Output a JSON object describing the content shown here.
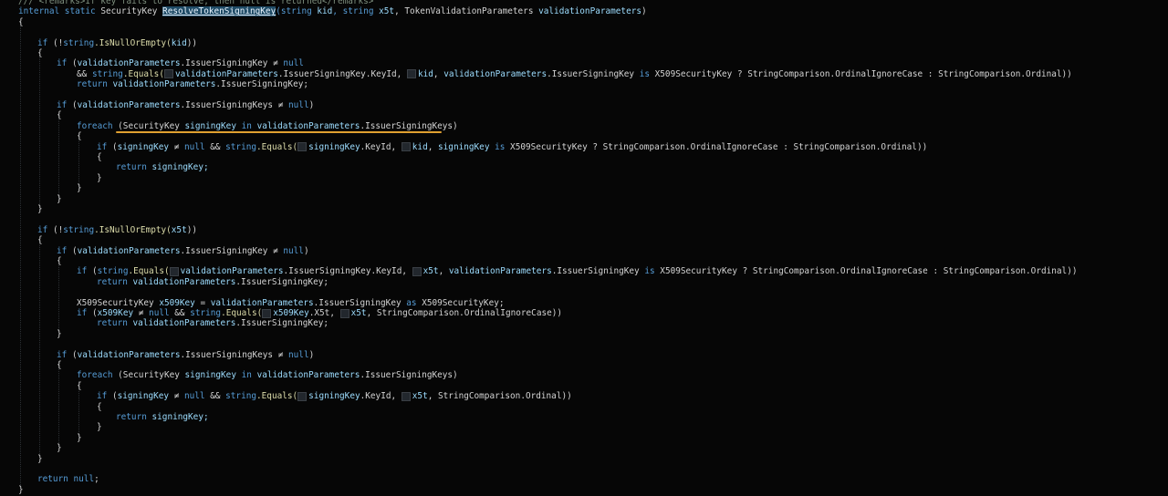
{
  "colors": {
    "background": "#060606",
    "keyword": "#569cd6",
    "identifier": "#9cdcfe",
    "text": "#d4d4d4",
    "comment": "#7e8f7e",
    "annotation": "#e0a030"
  },
  "code_lines": [
    {
      "indent": 1,
      "tokens": [
        {
          "t": "/// <remarks>If key fails to resolve, then null is returned</remarks>",
          "c": "cm"
        }
      ]
    },
    {
      "indent": 1,
      "tokens": [
        {
          "t": "internal static ",
          "c": "kw"
        },
        {
          "t": "SecurityKey ",
          "c": "ty"
        },
        {
          "t": "ResolveTokenSigningKey",
          "c": "hl"
        },
        {
          "t": "(string ",
          "c": "kw"
        },
        {
          "t": "kid",
          "c": "vr"
        },
        {
          "t": ", string ",
          "c": "kw"
        },
        {
          "t": "x5t",
          "c": "vr"
        },
        {
          "t": ", TokenValidationParameters ",
          "c": "ty"
        },
        {
          "t": "validationParameters",
          "c": "vr"
        },
        {
          "t": ")",
          "c": "pl"
        }
      ]
    },
    {
      "indent": 1,
      "tokens": [
        {
          "t": "{",
          "c": "pl"
        }
      ]
    },
    {
      "indent": 0,
      "tokens": []
    },
    {
      "indent": 2,
      "tokens": [
        {
          "t": "if ",
          "c": "kw"
        },
        {
          "t": "(!",
          "c": "pl"
        },
        {
          "t": "string",
          "c": "kw"
        },
        {
          "t": ".IsNullOrEmpty(",
          "c": "mt"
        },
        {
          "t": "kid",
          "c": "vr"
        },
        {
          "t": "))",
          "c": "pl"
        }
      ]
    },
    {
      "indent": 2,
      "tokens": [
        {
          "t": "{",
          "c": "pl"
        }
      ]
    },
    {
      "indent": 3,
      "tokens": [
        {
          "t": "if ",
          "c": "kw"
        },
        {
          "t": "(",
          "c": "pl"
        },
        {
          "t": "validationParameters",
          "c": "vr"
        },
        {
          "t": ".IssuerSigningKey ≠ ",
          "c": "pl"
        },
        {
          "t": "null",
          "c": "nu"
        }
      ]
    },
    {
      "indent": 4,
      "tokens": [
        {
          "t": "&& ",
          "c": "pl"
        },
        {
          "t": "string",
          "c": "kw"
        },
        {
          "t": ".Equals(",
          "c": "mt"
        },
        {
          "t": "",
          "c": "hint"
        },
        {
          "t": "validationParameters",
          "c": "vr"
        },
        {
          "t": ".IssuerSigningKey.KeyId, ",
          "c": "pl"
        },
        {
          "t": "",
          "c": "hint"
        },
        {
          "t": "kid",
          "c": "vr"
        },
        {
          "t": ", ",
          "c": "pl"
        },
        {
          "t": "validationParameters",
          "c": "vr"
        },
        {
          "t": ".IssuerSigningKey ",
          "c": "pl"
        },
        {
          "t": "is ",
          "c": "kw"
        },
        {
          "t": "X509SecurityKey ? StringComparison.OrdinalIgnoreCase : StringComparison.Ordinal))",
          "c": "pl"
        }
      ]
    },
    {
      "indent": 4,
      "tokens": [
        {
          "t": "return ",
          "c": "kw"
        },
        {
          "t": "validationParameters",
          "c": "vr"
        },
        {
          "t": ".IssuerSigningKey;",
          "c": "pl"
        }
      ]
    },
    {
      "indent": 0,
      "tokens": []
    },
    {
      "indent": 3,
      "tokens": [
        {
          "t": "if ",
          "c": "kw"
        },
        {
          "t": "(",
          "c": "pl"
        },
        {
          "t": "validationParameters",
          "c": "vr"
        },
        {
          "t": ".IssuerSigningKeys ≠ ",
          "c": "pl"
        },
        {
          "t": "null",
          "c": "nu"
        },
        {
          "t": ")",
          "c": "pl"
        }
      ]
    },
    {
      "indent": 3,
      "tokens": [
        {
          "t": "{",
          "c": "pl"
        }
      ]
    },
    {
      "indent": 4,
      "tokens": [
        {
          "t": "foreach ",
          "c": "kw"
        },
        {
          "t": "(SecurityKey ",
          "c": "pl"
        },
        {
          "t": "signingKey",
          "c": "vr"
        },
        {
          "t": " in ",
          "c": "kw"
        },
        {
          "t": "validationParameters",
          "c": "vr"
        },
        {
          "t": ".IssuerSigningKeys)",
          "c": "pl"
        }
      ]
    },
    {
      "indent": 4,
      "tokens": [
        {
          "t": "{",
          "c": "pl"
        }
      ]
    },
    {
      "indent": 5,
      "tokens": [
        {
          "t": "if ",
          "c": "kw"
        },
        {
          "t": "(",
          "c": "pl"
        },
        {
          "t": "signingKey",
          "c": "vr"
        },
        {
          "t": " ≠ ",
          "c": "pl"
        },
        {
          "t": "null",
          "c": "nu"
        },
        {
          "t": " && ",
          "c": "pl"
        },
        {
          "t": "string",
          "c": "kw"
        },
        {
          "t": ".Equals(",
          "c": "mt"
        },
        {
          "t": "",
          "c": "hint"
        },
        {
          "t": "signingKey",
          "c": "vr"
        },
        {
          "t": ".KeyId, ",
          "c": "pl"
        },
        {
          "t": "",
          "c": "hint"
        },
        {
          "t": "kid",
          "c": "vr"
        },
        {
          "t": ", ",
          "c": "pl"
        },
        {
          "t": "signingKey",
          "c": "vr"
        },
        {
          "t": " is ",
          "c": "kw"
        },
        {
          "t": "X509SecurityKey ? StringComparison.OrdinalIgnoreCase : StringComparison.Ordinal))",
          "c": "pl"
        }
      ]
    },
    {
      "indent": 5,
      "tokens": [
        {
          "t": "{",
          "c": "pl"
        }
      ]
    },
    {
      "indent": 6,
      "tokens": [
        {
          "t": "return ",
          "c": "kw"
        },
        {
          "t": "signingKey;",
          "c": "vr"
        }
      ]
    },
    {
      "indent": 5,
      "tokens": [
        {
          "t": "}",
          "c": "pl"
        }
      ]
    },
    {
      "indent": 4,
      "tokens": [
        {
          "t": "}",
          "c": "pl"
        }
      ]
    },
    {
      "indent": 3,
      "tokens": [
        {
          "t": "}",
          "c": "pl"
        }
      ]
    },
    {
      "indent": 2,
      "tokens": [
        {
          "t": "}",
          "c": "pl"
        }
      ]
    },
    {
      "indent": 0,
      "tokens": []
    },
    {
      "indent": 2,
      "tokens": [
        {
          "t": "if ",
          "c": "kw"
        },
        {
          "t": "(!",
          "c": "pl"
        },
        {
          "t": "string",
          "c": "kw"
        },
        {
          "t": ".IsNullOrEmpty(",
          "c": "mt"
        },
        {
          "t": "x5t",
          "c": "vr"
        },
        {
          "t": "))",
          "c": "pl"
        }
      ]
    },
    {
      "indent": 2,
      "tokens": [
        {
          "t": "{",
          "c": "pl"
        }
      ]
    },
    {
      "indent": 3,
      "tokens": [
        {
          "t": "if ",
          "c": "kw"
        },
        {
          "t": "(",
          "c": "pl"
        },
        {
          "t": "validationParameters",
          "c": "vr"
        },
        {
          "t": ".IssuerSigningKey ≠ ",
          "c": "pl"
        },
        {
          "t": "null",
          "c": "nu"
        },
        {
          "t": ")",
          "c": "pl"
        }
      ]
    },
    {
      "indent": 3,
      "tokens": [
        {
          "t": "{",
          "c": "pl"
        }
      ]
    },
    {
      "indent": 4,
      "tokens": [
        {
          "t": "if ",
          "c": "kw"
        },
        {
          "t": "(",
          "c": "pl"
        },
        {
          "t": "string",
          "c": "kw"
        },
        {
          "t": ".Equals(",
          "c": "mt"
        },
        {
          "t": "",
          "c": "hint"
        },
        {
          "t": "validationParameters",
          "c": "vr"
        },
        {
          "t": ".IssuerSigningKey.KeyId, ",
          "c": "pl"
        },
        {
          "t": "",
          "c": "hint"
        },
        {
          "t": "x5t",
          "c": "vr"
        },
        {
          "t": ", ",
          "c": "pl"
        },
        {
          "t": "validationParameters",
          "c": "vr"
        },
        {
          "t": ".IssuerSigningKey ",
          "c": "pl"
        },
        {
          "t": "is ",
          "c": "kw"
        },
        {
          "t": "X509SecurityKey ? StringComparison.OrdinalIgnoreCase : StringComparison.Ordinal))",
          "c": "pl"
        }
      ]
    },
    {
      "indent": 5,
      "tokens": [
        {
          "t": "return ",
          "c": "kw"
        },
        {
          "t": "validationParameters",
          "c": "vr"
        },
        {
          "t": ".IssuerSigningKey;",
          "c": "pl"
        }
      ]
    },
    {
      "indent": 0,
      "tokens": []
    },
    {
      "indent": 4,
      "tokens": [
        {
          "t": "X509SecurityKey ",
          "c": "pl"
        },
        {
          "t": "x509Key",
          "c": "vr"
        },
        {
          "t": " = ",
          "c": "pl"
        },
        {
          "t": "validationParameters",
          "c": "vr"
        },
        {
          "t": ".IssuerSigningKey ",
          "c": "pl"
        },
        {
          "t": "as ",
          "c": "kw"
        },
        {
          "t": "X509SecurityKey;",
          "c": "pl"
        }
      ]
    },
    {
      "indent": 4,
      "tokens": [
        {
          "t": "if ",
          "c": "kw"
        },
        {
          "t": "(",
          "c": "pl"
        },
        {
          "t": "x509Key",
          "c": "vr"
        },
        {
          "t": " ≠ ",
          "c": "pl"
        },
        {
          "t": "null",
          "c": "nu"
        },
        {
          "t": " && ",
          "c": "pl"
        },
        {
          "t": "string",
          "c": "kw"
        },
        {
          "t": ".Equals(",
          "c": "mt"
        },
        {
          "t": "",
          "c": "hint"
        },
        {
          "t": "x509Key",
          "c": "vr"
        },
        {
          "t": ".X5t, ",
          "c": "pl"
        },
        {
          "t": "",
          "c": "hint"
        },
        {
          "t": "x5t",
          "c": "vr"
        },
        {
          "t": ", StringComparison.OrdinalIgnoreCase))",
          "c": "pl"
        }
      ]
    },
    {
      "indent": 5,
      "tokens": [
        {
          "t": "return ",
          "c": "kw"
        },
        {
          "t": "validationParameters",
          "c": "vr"
        },
        {
          "t": ".IssuerSigningKey;",
          "c": "pl"
        }
      ]
    },
    {
      "indent": 3,
      "tokens": [
        {
          "t": "}",
          "c": "pl"
        }
      ]
    },
    {
      "indent": 0,
      "tokens": []
    },
    {
      "indent": 3,
      "tokens": [
        {
          "t": "if ",
          "c": "kw"
        },
        {
          "t": "(",
          "c": "pl"
        },
        {
          "t": "validationParameters",
          "c": "vr"
        },
        {
          "t": ".IssuerSigningKeys ≠ ",
          "c": "pl"
        },
        {
          "t": "null",
          "c": "nu"
        },
        {
          "t": ")",
          "c": "pl"
        }
      ]
    },
    {
      "indent": 3,
      "tokens": [
        {
          "t": "{",
          "c": "pl"
        }
      ]
    },
    {
      "indent": 4,
      "tokens": [
        {
          "t": "foreach ",
          "c": "kw"
        },
        {
          "t": "(SecurityKey ",
          "c": "pl"
        },
        {
          "t": "signingKey",
          "c": "vr"
        },
        {
          "t": " in ",
          "c": "kw"
        },
        {
          "t": "validationParameters",
          "c": "vr"
        },
        {
          "t": ".IssuerSigningKeys)",
          "c": "pl"
        }
      ]
    },
    {
      "indent": 4,
      "tokens": [
        {
          "t": "{",
          "c": "pl"
        }
      ]
    },
    {
      "indent": 5,
      "tokens": [
        {
          "t": "if ",
          "c": "kw"
        },
        {
          "t": "(",
          "c": "pl"
        },
        {
          "t": "signingKey",
          "c": "vr"
        },
        {
          "t": " ≠ ",
          "c": "pl"
        },
        {
          "t": "null",
          "c": "nu"
        },
        {
          "t": " && ",
          "c": "pl"
        },
        {
          "t": "string",
          "c": "kw"
        },
        {
          "t": ".Equals(",
          "c": "mt"
        },
        {
          "t": "",
          "c": "hint"
        },
        {
          "t": "signingKey",
          "c": "vr"
        },
        {
          "t": ".KeyId, ",
          "c": "pl"
        },
        {
          "t": "",
          "c": "hint"
        },
        {
          "t": "x5t",
          "c": "vr"
        },
        {
          "t": ", StringComparison.Ordinal))",
          "c": "pl"
        }
      ]
    },
    {
      "indent": 5,
      "tokens": [
        {
          "t": "{",
          "c": "pl"
        }
      ]
    },
    {
      "indent": 6,
      "tokens": [
        {
          "t": "return ",
          "c": "kw"
        },
        {
          "t": "signingKey;",
          "c": "vr"
        }
      ]
    },
    {
      "indent": 5,
      "tokens": [
        {
          "t": "}",
          "c": "pl"
        }
      ]
    },
    {
      "indent": 4,
      "tokens": [
        {
          "t": "}",
          "c": "pl"
        }
      ]
    },
    {
      "indent": 3,
      "tokens": [
        {
          "t": "}",
          "c": "pl"
        }
      ]
    },
    {
      "indent": 2,
      "tokens": [
        {
          "t": "}",
          "c": "pl"
        }
      ]
    },
    {
      "indent": 0,
      "tokens": []
    },
    {
      "indent": 2,
      "tokens": [
        {
          "t": "return ",
          "c": "kw"
        },
        {
          "t": "null",
          "c": "nu"
        },
        {
          "t": ";",
          "c": "pl"
        }
      ]
    },
    {
      "indent": 1,
      "tokens": [
        {
          "t": "}",
          "c": "pl"
        }
      ]
    }
  ]
}
